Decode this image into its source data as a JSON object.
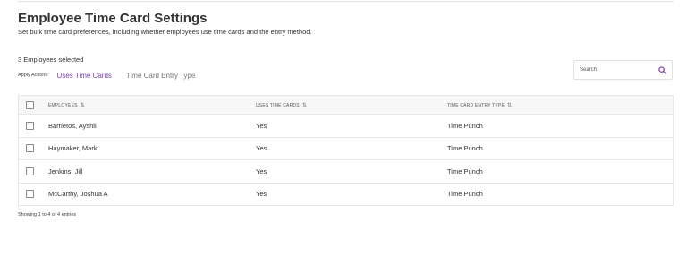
{
  "page": {
    "title": "Employee Time Card Settings",
    "subtitle": "Set bulk time card preferences, including whether employees use time cards and the entry method."
  },
  "selection": {
    "count_text": "3 Employees selected"
  },
  "apply_actions": {
    "label": "Apply Actions:",
    "tabs": [
      {
        "label": "Uses Time Cards",
        "active": true
      },
      {
        "label": "Time Card Entry Type",
        "active": false
      }
    ]
  },
  "search": {
    "placeholder": "Search",
    "value": "",
    "icon": "search-icon"
  },
  "table": {
    "columns": [
      "EMPLOYEES",
      "USES TIME CARDS",
      "TIME CARD ENTRY TYPE"
    ],
    "sort_icon": "⇅",
    "rows": [
      {
        "employee": "Barrietos, Ayshli",
        "uses_time_cards": "Yes",
        "entry_type": "Time Punch"
      },
      {
        "employee": "Haymaker, Mark",
        "uses_time_cards": "Yes",
        "entry_type": "Time Punch"
      },
      {
        "employee": "Jenkins, Jill",
        "uses_time_cards": "Yes",
        "entry_type": "Time Punch"
      },
      {
        "employee": "McCarthy, Joshua A",
        "uses_time_cards": "Yes",
        "entry_type": "Time Punch"
      }
    ]
  },
  "footer": {
    "entries_text": "Showing 1 to 4 of 4 entries"
  },
  "colors": {
    "accent": "#7b3fb0",
    "border": "#e6e6e6",
    "header_bg": "#f7f7f7"
  }
}
